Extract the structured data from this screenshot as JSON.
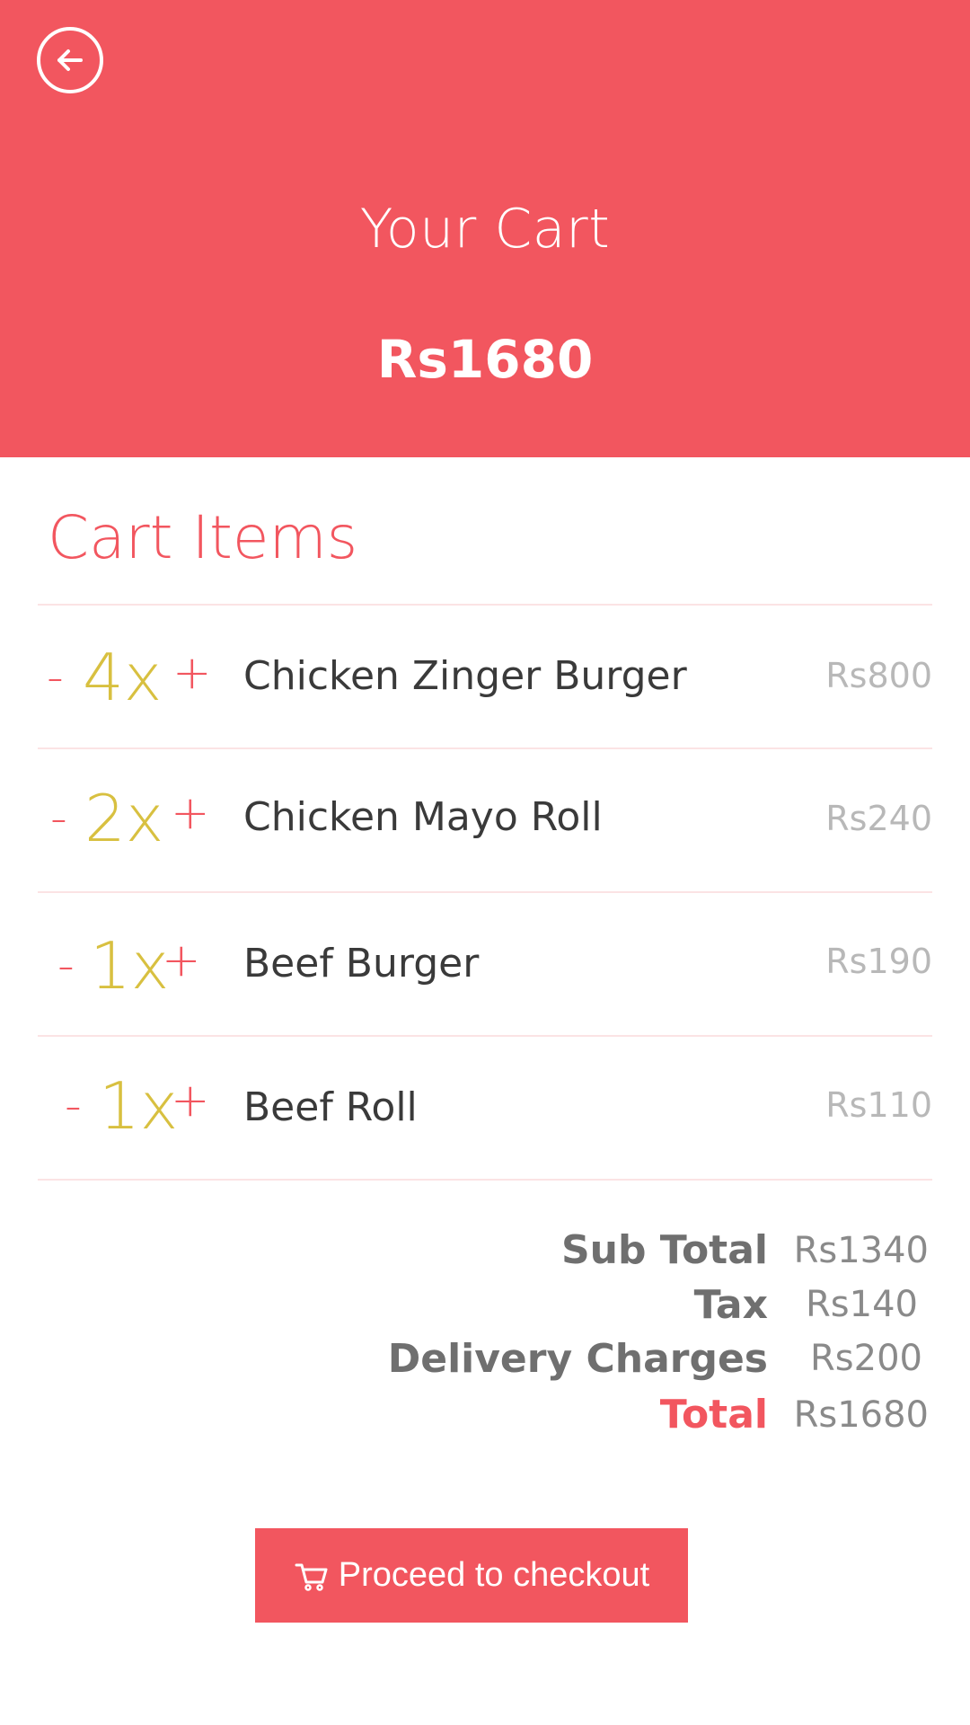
{
  "header": {
    "title": "Your Cart",
    "total": "Rs1680",
    "back_icon": "arrow-left-circle-icon",
    "background_color": "#f2565f"
  },
  "cart": {
    "section_title": "Cart Items",
    "items": [
      {
        "minus": "-",
        "quantity": "4x",
        "plus": "+",
        "name": "Chicken Zinger Burger",
        "price": "Rs800"
      },
      {
        "minus": "-",
        "quantity": "2x",
        "plus": "+",
        "name": "Chicken Mayo Roll",
        "price": "Rs240"
      },
      {
        "minus": "-",
        "quantity": "1x",
        "plus": "+",
        "name": "Beef Burger",
        "price": "Rs190"
      },
      {
        "minus": "-",
        "quantity": "1x",
        "plus": "+",
        "name": "Beef Roll",
        "price": "Rs110"
      }
    ]
  },
  "summary": {
    "subtotal_label": "Sub Total",
    "subtotal_value": "Rs1340",
    "tax_label": "Tax",
    "tax_value": "Rs140",
    "delivery_label": "Delivery Charges",
    "delivery_value": "Rs200",
    "total_label": "Total",
    "total_value": "Rs1680"
  },
  "checkout": {
    "label": "Proceed to checkout",
    "icon": "shopping-cart-icon"
  },
  "colors": {
    "accent": "#f2565f",
    "quantity": "#d8c040",
    "price": "#b8b8b8"
  }
}
